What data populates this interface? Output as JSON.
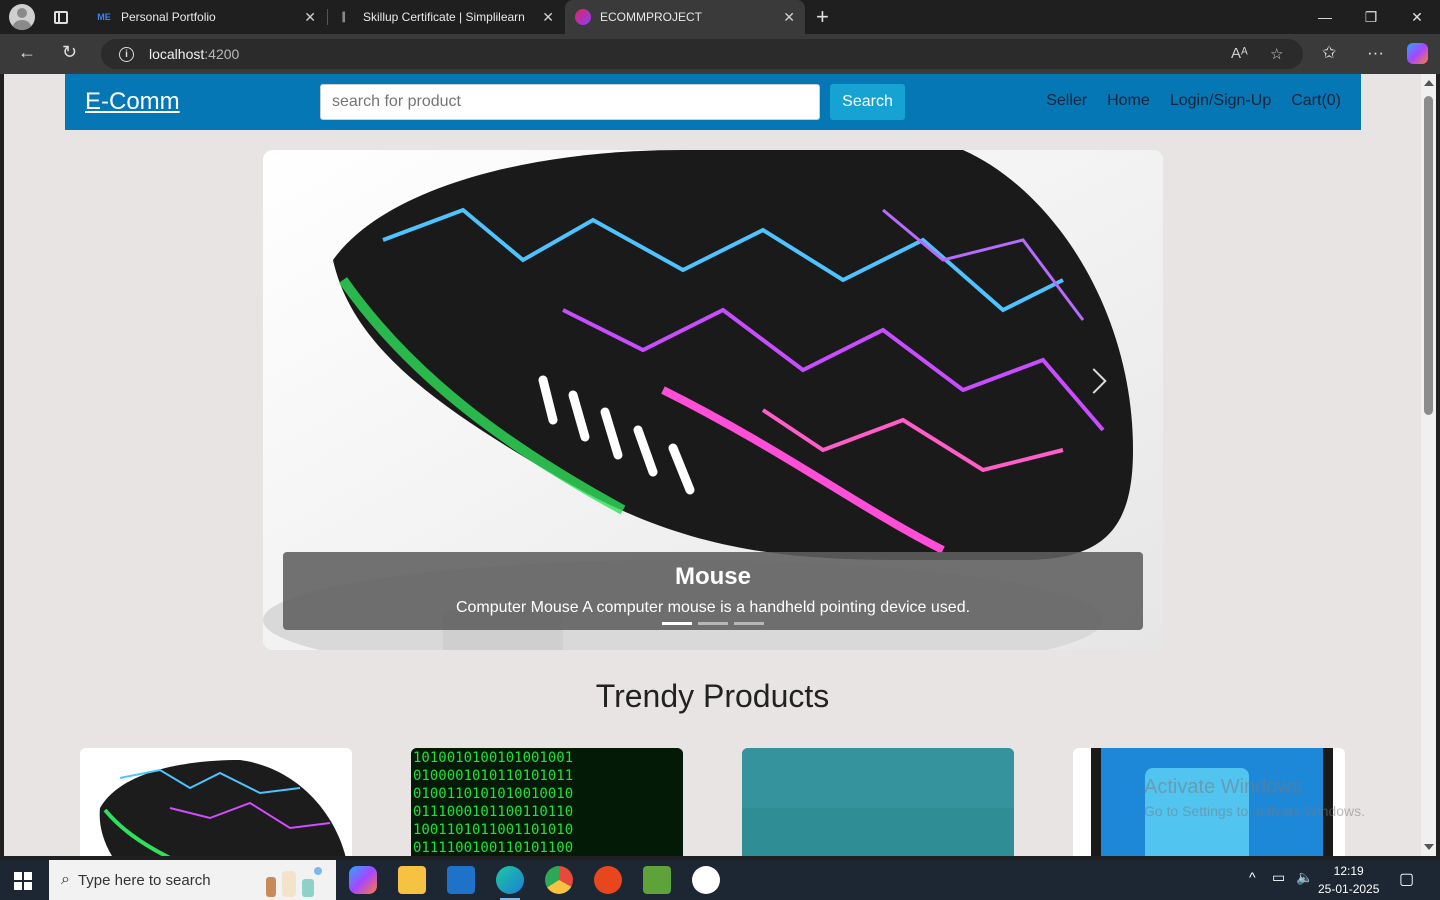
{
  "browser": {
    "tabs": [
      {
        "label": "Personal Portfolio",
        "icon": "me-favicon"
      },
      {
        "label": "Skillup Certificate | Simplilearn",
        "icon": "simplilearn-favicon"
      },
      {
        "label": "ECOMMPROJECT",
        "icon": "angular-favicon",
        "active": true
      }
    ],
    "address": {
      "host": "localhost",
      "port": ":4200"
    }
  },
  "site": {
    "logo": "E-Comm",
    "search": {
      "placeholder": "search for product",
      "button": "Search"
    },
    "nav": [
      "Seller",
      "Home",
      "Login/Sign-Up",
      "Cart(0)"
    ],
    "colors": {
      "header": "#0677b5",
      "search_button": "#17a2d4"
    }
  },
  "carousel": {
    "title": "Mouse",
    "description": "Computer Mouse A computer mouse is a handheld pointing device used.",
    "slide_count": 3,
    "active_slide": 1
  },
  "trendy": {
    "title": "Trendy Products"
  },
  "watermark": {
    "line1": "Activate Windows",
    "line2": "Go to Settings to activate Windows."
  },
  "taskbar": {
    "search_placeholder": "Type here to search",
    "time": "12:19",
    "date": "25-01-2025"
  }
}
